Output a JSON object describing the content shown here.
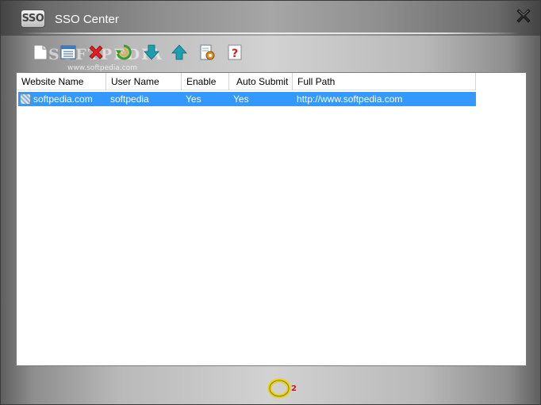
{
  "window": {
    "title": "SSO Center",
    "logo_text": "SSO"
  },
  "toolbar": {
    "buttons": [
      {
        "name": "new-document-icon"
      },
      {
        "name": "edit-list-icon"
      },
      {
        "name": "delete-icon"
      },
      {
        "name": "refresh-icon"
      },
      {
        "name": "move-down-icon"
      },
      {
        "name": "move-up-icon"
      },
      {
        "name": "settings-icon"
      },
      {
        "name": "help-icon"
      }
    ]
  },
  "watermark": {
    "text": "SOFTPEDIA",
    "sub": "www.softpedia.com"
  },
  "table": {
    "columns": [
      "Website Name",
      "User Name",
      "Enable",
      "Auto Submit",
      "Full Path"
    ],
    "rows": [
      [
        "softpedia.com",
        "softpedia",
        "Yes",
        "Yes",
        "http://www.softpedia.com"
      ]
    ]
  },
  "footer": {
    "logo_text": "2"
  },
  "colors": {
    "selection": "#3399ff",
    "delete": "#e02020",
    "refresh": "#3a9a2a",
    "arrow": "#1e9fb0",
    "help": "#d02020"
  }
}
